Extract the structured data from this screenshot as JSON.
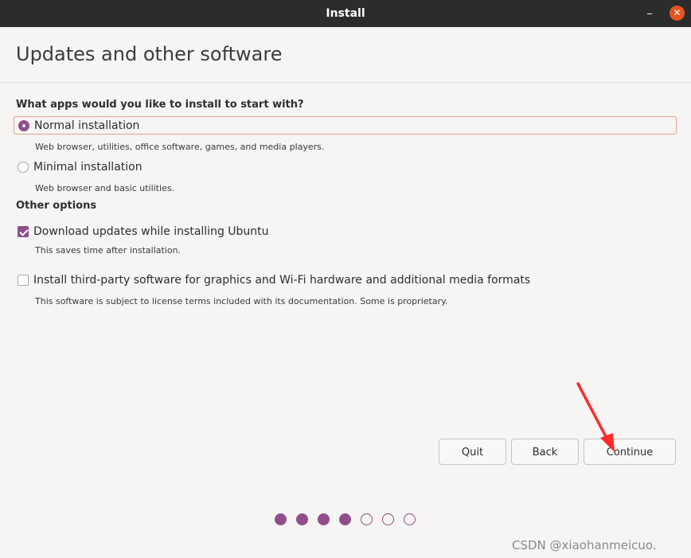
{
  "window": {
    "title": "Install",
    "minimize_glyph": "–",
    "close_glyph": "✕"
  },
  "page": {
    "title": "Updates and other software"
  },
  "apps_section": {
    "heading": "What apps would you like to install to start with?",
    "options": [
      {
        "label": "Normal installation",
        "description": "Web browser, utilities, office software, games, and media players.",
        "selected": true
      },
      {
        "label": "Minimal installation",
        "description": "Web browser and basic utilities.",
        "selected": false
      }
    ]
  },
  "other_section": {
    "heading": "Other options",
    "options": [
      {
        "label": "Download updates while installing Ubuntu",
        "description": "This saves time after installation.",
        "checked": true
      },
      {
        "label": "Install third-party software for graphics and Wi-Fi hardware and additional media formats",
        "description": "This software is subject to license terms included with its documentation. Some is proprietary.",
        "checked": false
      }
    ]
  },
  "buttons": {
    "quit": "Quit",
    "back": "Back",
    "continue": "Continue"
  },
  "progress": {
    "total_steps": 7,
    "completed_steps": 4
  },
  "watermark": "CSDN @xiaohanmeicuo.",
  "colors": {
    "accent": "#924d8b",
    "close": "#e95420",
    "arrow": "#ff2a2a"
  }
}
